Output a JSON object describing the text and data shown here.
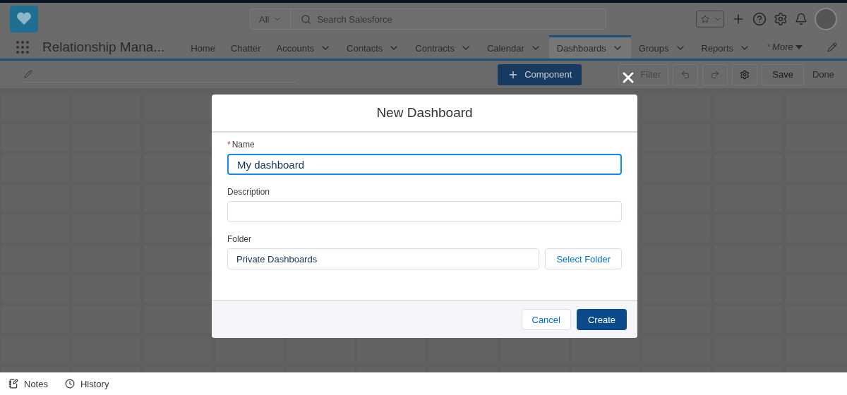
{
  "header": {
    "search": {
      "scope": "All",
      "placeholder": "Search Salesforce"
    }
  },
  "nav": {
    "app_name": "Relationship Mana...",
    "tabs": [
      {
        "label": "Home",
        "menu": false,
        "selected": false
      },
      {
        "label": "Chatter",
        "menu": false,
        "selected": false
      },
      {
        "label": "Accounts",
        "menu": true,
        "selected": false
      },
      {
        "label": "Contacts",
        "menu": true,
        "selected": false
      },
      {
        "label": "Contracts",
        "menu": true,
        "selected": false
      },
      {
        "label": "Calendar",
        "menu": true,
        "selected": false
      },
      {
        "label": "Dashboards",
        "menu": true,
        "selected": true
      },
      {
        "label": "Groups",
        "menu": true,
        "selected": false
      },
      {
        "label": "Reports",
        "menu": true,
        "selected": false
      }
    ],
    "more": {
      "mark": "*",
      "label": "More"
    }
  },
  "toolbar": {
    "component": "Component",
    "filter": {
      "label": "Filter",
      "disabled": true
    },
    "save": "Save",
    "done": "Done"
  },
  "modal": {
    "title": "New Dashboard",
    "fields": [
      {
        "kind": "text",
        "label": "Name",
        "required": true,
        "value": "My dashboard",
        "focused": true
      },
      {
        "kind": "text",
        "label": "Description",
        "required": false,
        "focused": false
      },
      {
        "kind": "folder",
        "label": "Folder",
        "required": false,
        "value": "Private Dashboards",
        "focused": false,
        "button": "Select Folder"
      }
    ],
    "cancel": "Cancel",
    "create": "Create"
  },
  "footer": [
    {
      "kind": "notes",
      "label": "Notes"
    },
    {
      "kind": "history",
      "label": "History"
    }
  ]
}
